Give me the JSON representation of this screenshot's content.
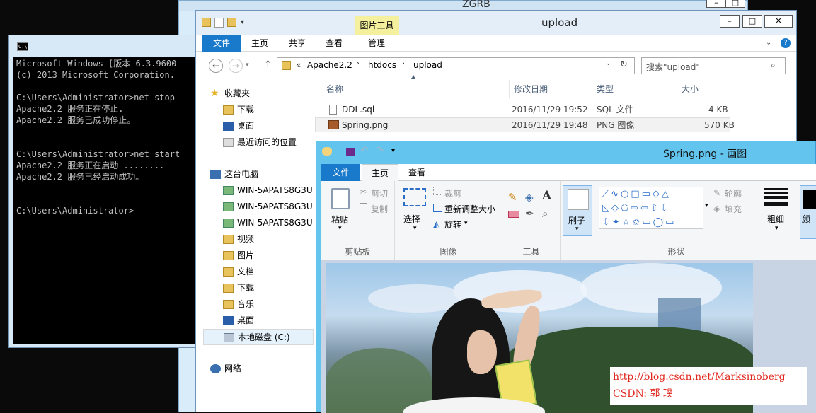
{
  "background_window": {
    "title": "ZGRB"
  },
  "cmd": {
    "lines": [
      "Microsoft Windows [版本 6.3.9600",
      "(c) 2013 Microsoft Corporation.",
      "",
      "C:\\Users\\Administrator>net stop",
      "Apache2.2 服务正在停止.",
      "Apache2.2 服务已成功停止。",
      "",
      "",
      "C:\\Users\\Administrator>net start",
      "Apache2.2 服务正在启动 ........",
      "Apache2.2 服务已经启动成功。",
      "",
      "",
      "C:\\Users\\Administrator>"
    ]
  },
  "explorer": {
    "title": "upload",
    "context_tab": "图片工具",
    "tabs": [
      "文件",
      "主页",
      "共享",
      "查看",
      "管理"
    ],
    "breadcrumb": [
      "«",
      "Apache2.2",
      "htdocs",
      "upload"
    ],
    "search_placeholder": "搜索\"upload\"",
    "nav": {
      "favorites": "收藏夹",
      "favorites_items": [
        "下载",
        "桌面",
        "最近访问的位置"
      ],
      "this_pc": "这台电脑",
      "pc_items": [
        "WIN-5APATS8G3U",
        "WIN-5APATS8G3U",
        "WIN-5APATS8G3U",
        "视频",
        "图片",
        "文档",
        "下载",
        "音乐",
        "桌面",
        "本地磁盘 (C:)"
      ],
      "network": "网络"
    },
    "columns": [
      "名称",
      "修改日期",
      "类型",
      "大小"
    ],
    "files": [
      {
        "name": "DDL.sql",
        "date": "2016/11/29 19:52",
        "type": "SQL 文件",
        "size": "4 KB"
      },
      {
        "name": "Spring.png",
        "date": "2016/11/29 19:48",
        "type": "PNG 图像",
        "size": "570 KB"
      }
    ]
  },
  "paint": {
    "title": "Spring.png - 画图",
    "tabs": [
      "文件",
      "主页",
      "查看"
    ],
    "clipboard": {
      "paste": "粘贴",
      "cut": "剪切",
      "copy": "复制",
      "label": "剪贴板"
    },
    "image": {
      "select": "选择",
      "crop": "裁剪",
      "resize": "重新调整大小",
      "rotate": "旋转",
      "label": "图像"
    },
    "tools": {
      "label": "工具",
      "brush": "刷子"
    },
    "shapes": {
      "outline": "轮廓",
      "fill": "填充",
      "label": "形状"
    },
    "size": "粗细",
    "color_partial": "颜"
  },
  "watermark": {
    "url": "http://blog.csdn.net/Marksinoberg",
    "author": "CSDN: 郭 璞"
  },
  "colors": {
    "accent": "#1979ca",
    "context_tab": "#f4f09d",
    "paint_title": "#63c5ee"
  }
}
